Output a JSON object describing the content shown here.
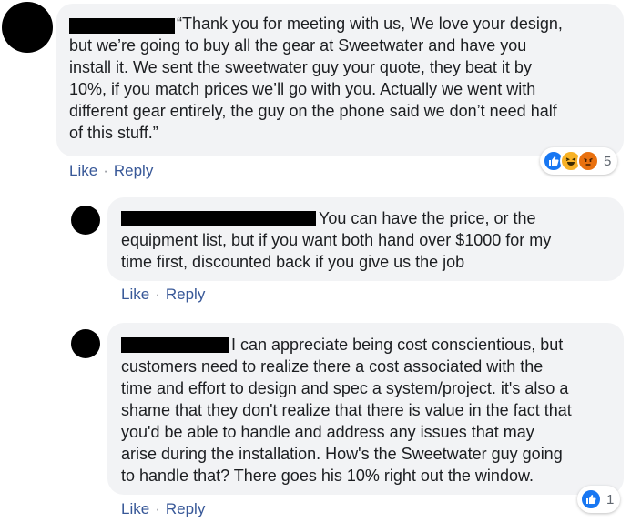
{
  "comments": [
    {
      "text": "“Thank you for meeting with us, We love your design,\nbut we’re going to buy all the gear at Sweetwater and have you\ninstall it. We sent the sweetwater guy your quote, they beat it by\n10%, if you match prices we’ll go with you. Actually we went with\ndifferent gear entirely, the guy on the phone said we don’t need half\nof this stuff.”",
      "like_label": "Like",
      "reply_label": "Reply",
      "separator": "·",
      "reactions": {
        "icons": [
          "like-icon",
          "haha-icon",
          "angry-icon"
        ],
        "count": "5"
      }
    },
    {
      "text": "You can have the price, or the\nequipment list, but if you want both hand over $1000 for my\ntime first, discounted back if you give us the job",
      "like_label": "Like",
      "reply_label": "Reply",
      "separator": "·"
    },
    {
      "text": "I can appreciate being cost conscientious, but\ncustomers need to realize there a cost associated with the\ntime and effort to design and spec a system/project. it's also a\nshame that they don't realize that there is value in the fact that\nyou'd be able to handle and address any issues that may\narise during the installation. How's the Sweetwater guy going\nto handle that? There goes his 10% right out the window.",
      "like_label": "Like",
      "reply_label": "Reply",
      "separator": "·",
      "reactions": {
        "icons": [
          "like-icon"
        ],
        "count": "1"
      }
    }
  ],
  "colors": {
    "bubble": "#f2f3f5",
    "link": "#385898",
    "like": "#1877f2",
    "haha": "#f7b125",
    "angry": "#e9710f"
  }
}
